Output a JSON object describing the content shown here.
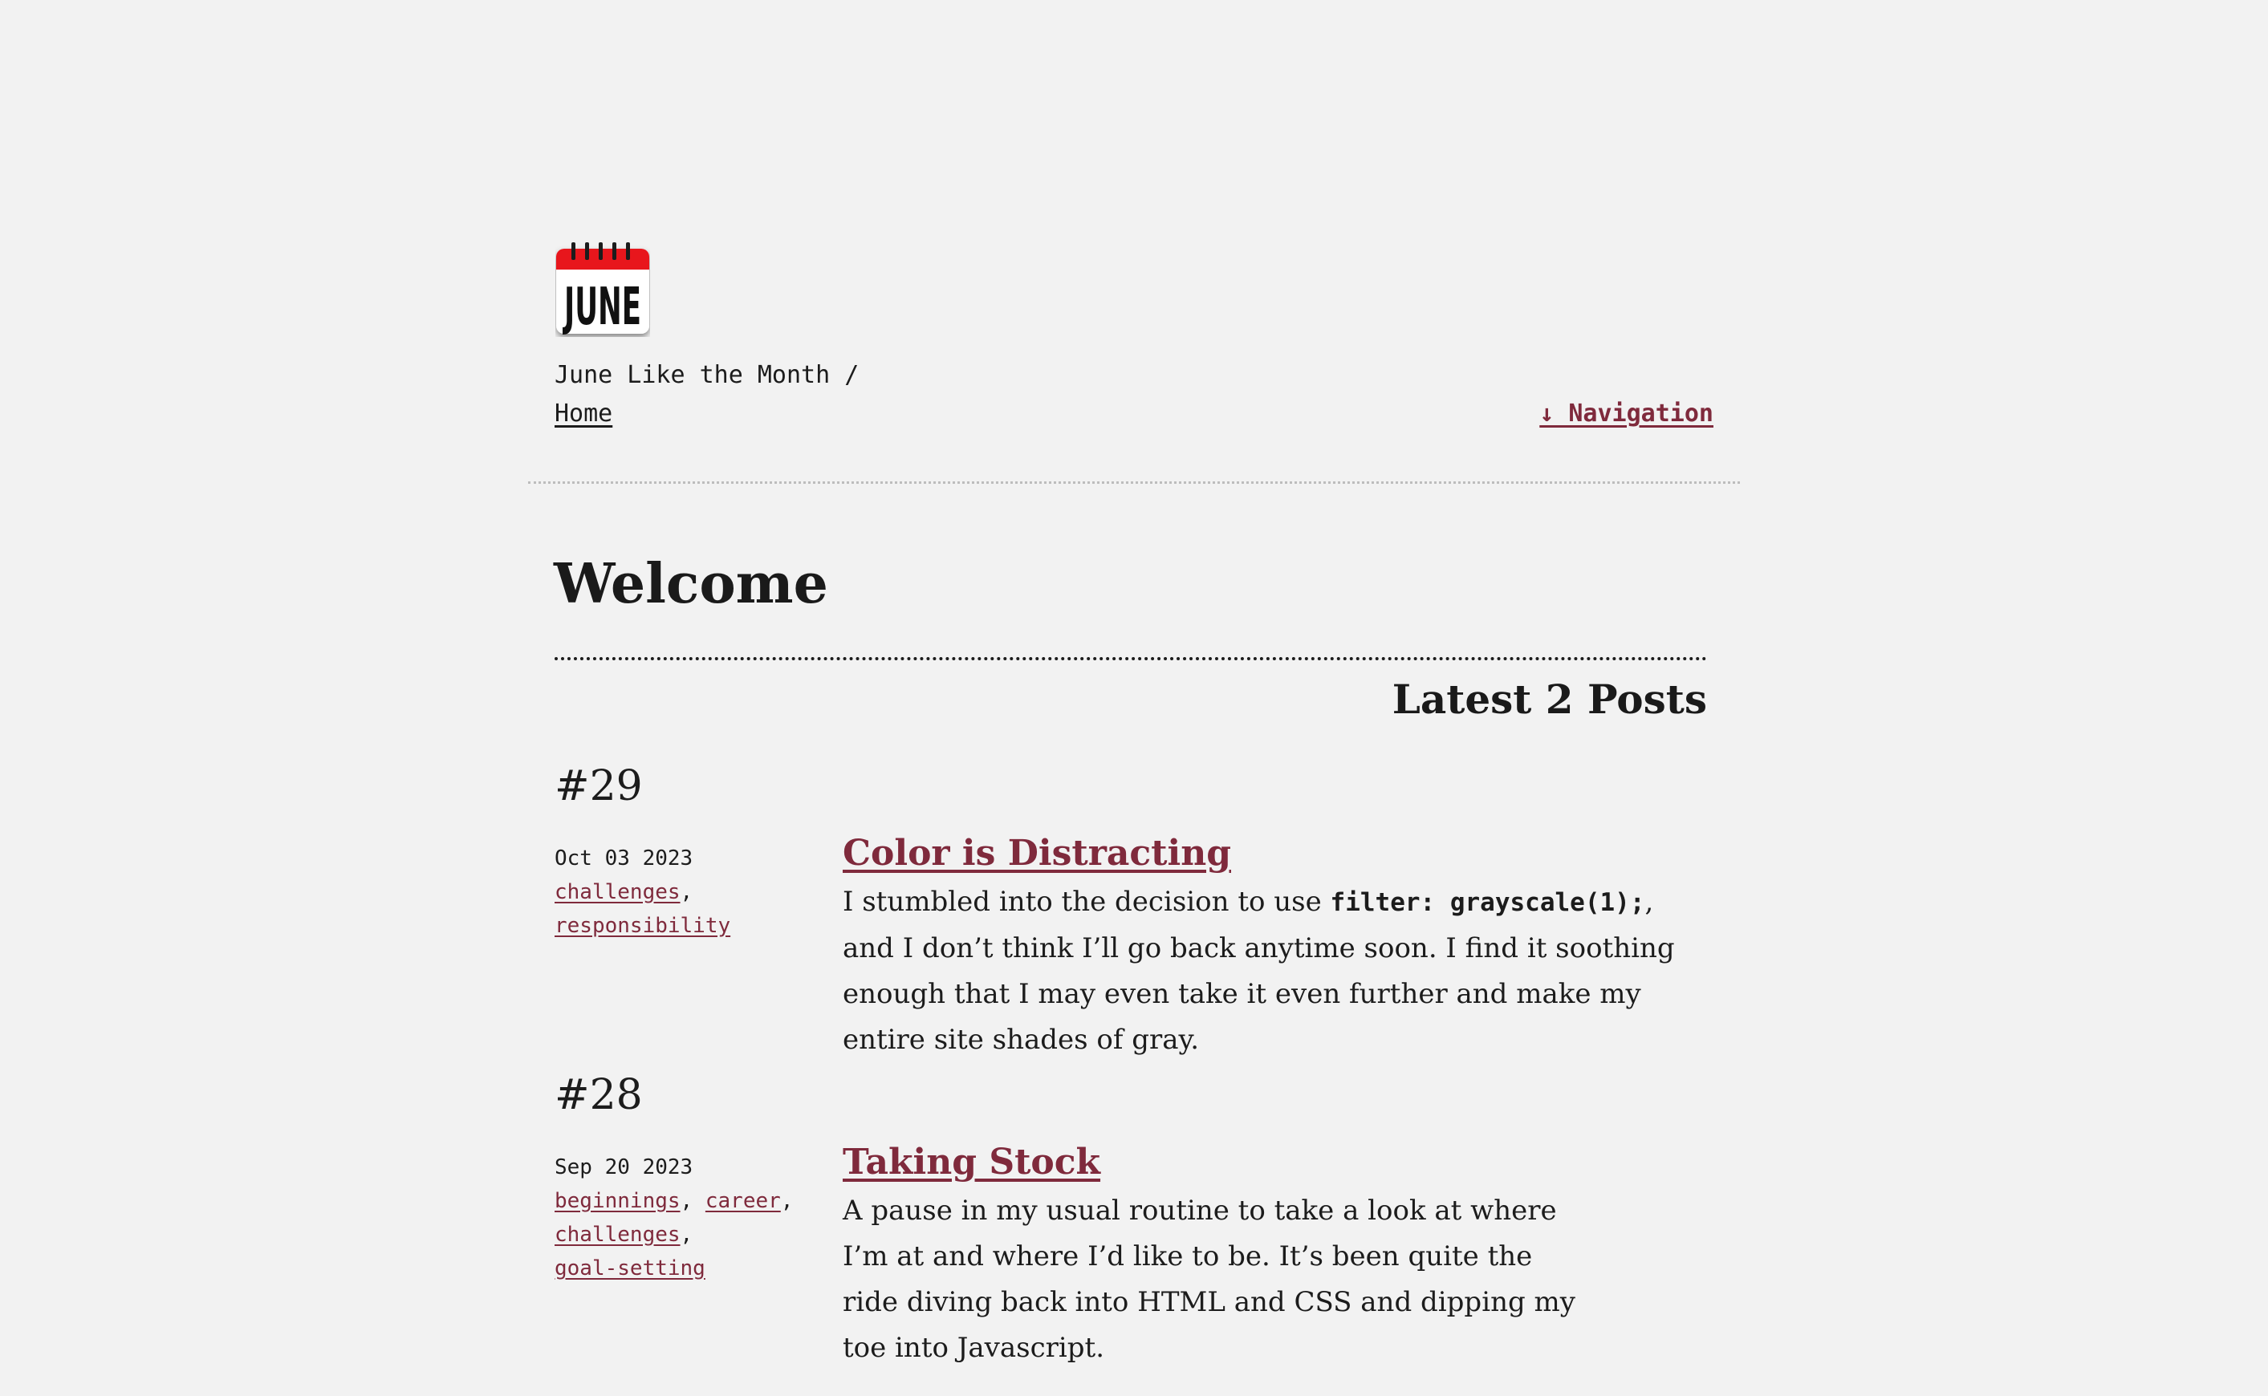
{
  "header": {
    "logo": {
      "text": "JUNE",
      "icon": "calendar-icon",
      "accent_color": "#e8121c"
    },
    "site_name": "June Like the Month /",
    "breadcrumb_home": "Home",
    "nav_link": "↓ Navigation"
  },
  "main": {
    "title": "Welcome",
    "latest_heading": "Latest 2 Posts",
    "posts": [
      {
        "number": "#29",
        "date": "Oct 03 2023",
        "tags": [
          "challenges",
          "responsibility"
        ],
        "title": "Color is Distracting",
        "excerpt_before": "I stumbled into the decision to use ",
        "excerpt_code": "filter: grayscale(1);",
        "excerpt_after": ", and I don’t think I’ll go back anytime soon. I find it soothing enough that I may even take it even further and make my entire site shades of gray."
      },
      {
        "number": "#28",
        "date": "Sep 20 2023",
        "tags": [
          "beginnings",
          "career",
          "challenges",
          "goal-setting"
        ],
        "title": "Taking Stock",
        "excerpt": "A pause in my usual routine to take a look at where I’m at and where I’d like to be. It’s been quite the ride diving back into HTML and CSS and dipping my toe into Javascript."
      }
    ]
  },
  "colors": {
    "background": "#f2f2f2",
    "text": "#1c1c1c",
    "link_accent": "#7f2a3c"
  }
}
